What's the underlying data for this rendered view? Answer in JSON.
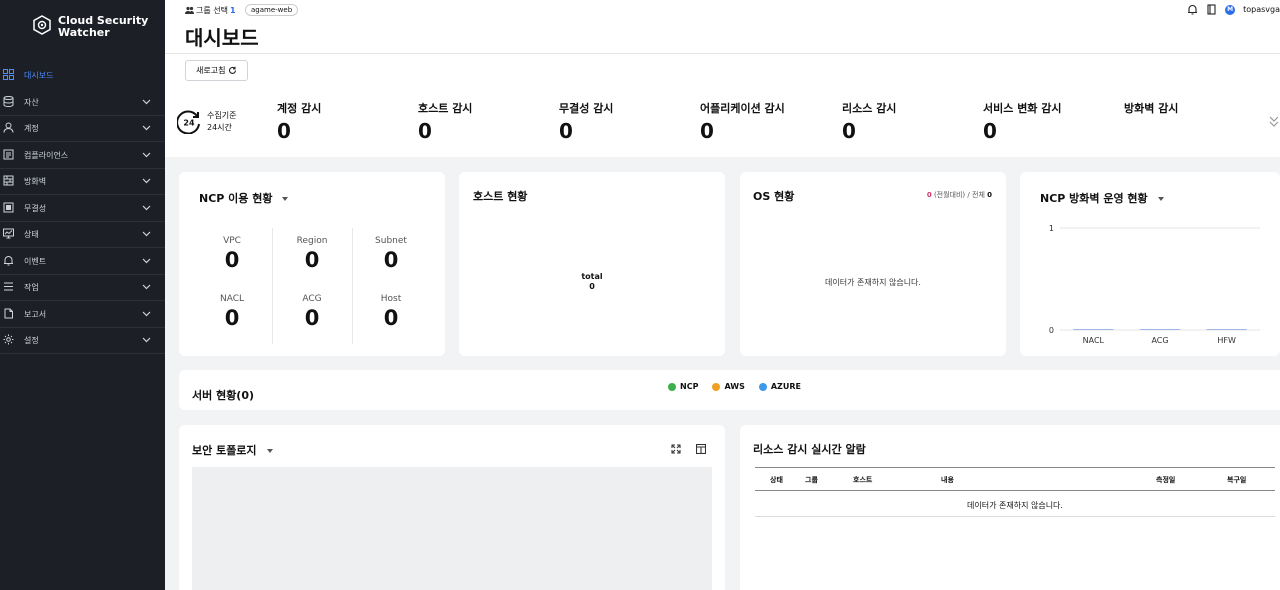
{
  "app": {
    "name_line1": "Cloud Security",
    "name_line2": "Watcher"
  },
  "sidebar": {
    "items": [
      {
        "label": "대시보드",
        "icon": "grid-icon"
      },
      {
        "label": "자산",
        "icon": "database-icon"
      },
      {
        "label": "계정",
        "icon": "user-icon"
      },
      {
        "label": "컴플라이언스",
        "icon": "document-icon"
      },
      {
        "label": "방화벽",
        "icon": "firewall-icon"
      },
      {
        "label": "무결성",
        "icon": "integrity-icon"
      },
      {
        "label": "상태",
        "icon": "monitor-icon"
      },
      {
        "label": "이벤트",
        "icon": "bell-icon"
      },
      {
        "label": "작업",
        "icon": "list-icon"
      },
      {
        "label": "보고서",
        "icon": "report-icon"
      },
      {
        "label": "설정",
        "icon": "gear-icon"
      }
    ]
  },
  "header": {
    "group_label": "그룹 선택",
    "group_count": "1",
    "group_tag": "agame-web",
    "title": "대시보드",
    "user": "topasvga",
    "user_initial": "M"
  },
  "toolbar": {
    "refresh_label": "새로고침"
  },
  "summary": {
    "badge_number": "24",
    "badge_line1": "수집기준",
    "badge_line2": "24시간",
    "stats": [
      {
        "label": "계정 감시",
        "value": "0"
      },
      {
        "label": "호스트 감시",
        "value": "0"
      },
      {
        "label": "무결성 감시",
        "value": "0"
      },
      {
        "label": "어플리케이션 감시",
        "value": "0"
      },
      {
        "label": "리소스 감시",
        "value": "0"
      },
      {
        "label": "서비스 변화 감시",
        "value": "0"
      },
      {
        "label": "방화벽 감시",
        "value": ""
      }
    ]
  },
  "ncp_usage": {
    "title": "NCP 이용 현황",
    "cells": [
      {
        "label": "VPC",
        "value": "0"
      },
      {
        "label": "Region",
        "value": "0"
      },
      {
        "label": "Subnet",
        "value": "0"
      },
      {
        "label": "NACL",
        "value": "0"
      },
      {
        "label": "ACG",
        "value": "0"
      },
      {
        "label": "Host",
        "value": "0"
      }
    ]
  },
  "host_status": {
    "title": "호스트 현황",
    "total_label": "total",
    "total_value": "0"
  },
  "os_status": {
    "title": "OS 현황",
    "delta_value": "0",
    "delta_label": "(전월대비)",
    "sep": "/",
    "total_label": "전체",
    "total_value": "0",
    "empty": "데이터가 존재하지 않습니다."
  },
  "ncp_firewall": {
    "title": "NCP 방화벽 운영 현황"
  },
  "chart_data": {
    "type": "bar",
    "categories": [
      "NACL",
      "ACG",
      "HFW"
    ],
    "values": [
      0,
      0,
      0
    ],
    "title": "",
    "ylim": [
      0,
      1
    ],
    "yticks": [
      "1",
      "0"
    ],
    "grid": true,
    "bar_color": "#9fb8e8"
  },
  "server_status": {
    "title": "서버 현황(0)",
    "legend": [
      {
        "label": "NCP",
        "color": "#3cb04a"
      },
      {
        "label": "AWS",
        "color": "#f0a020"
      },
      {
        "label": "AZURE",
        "color": "#3c9ae8"
      }
    ]
  },
  "topology": {
    "title": "보안 토폴로지"
  },
  "alarm": {
    "title": "리소스 감시 실시간 알람",
    "columns": [
      "상태",
      "그룹",
      "호스트",
      "내용",
      "측정일",
      "복구일"
    ],
    "empty": "데이터가 존재하지 않습니다."
  }
}
